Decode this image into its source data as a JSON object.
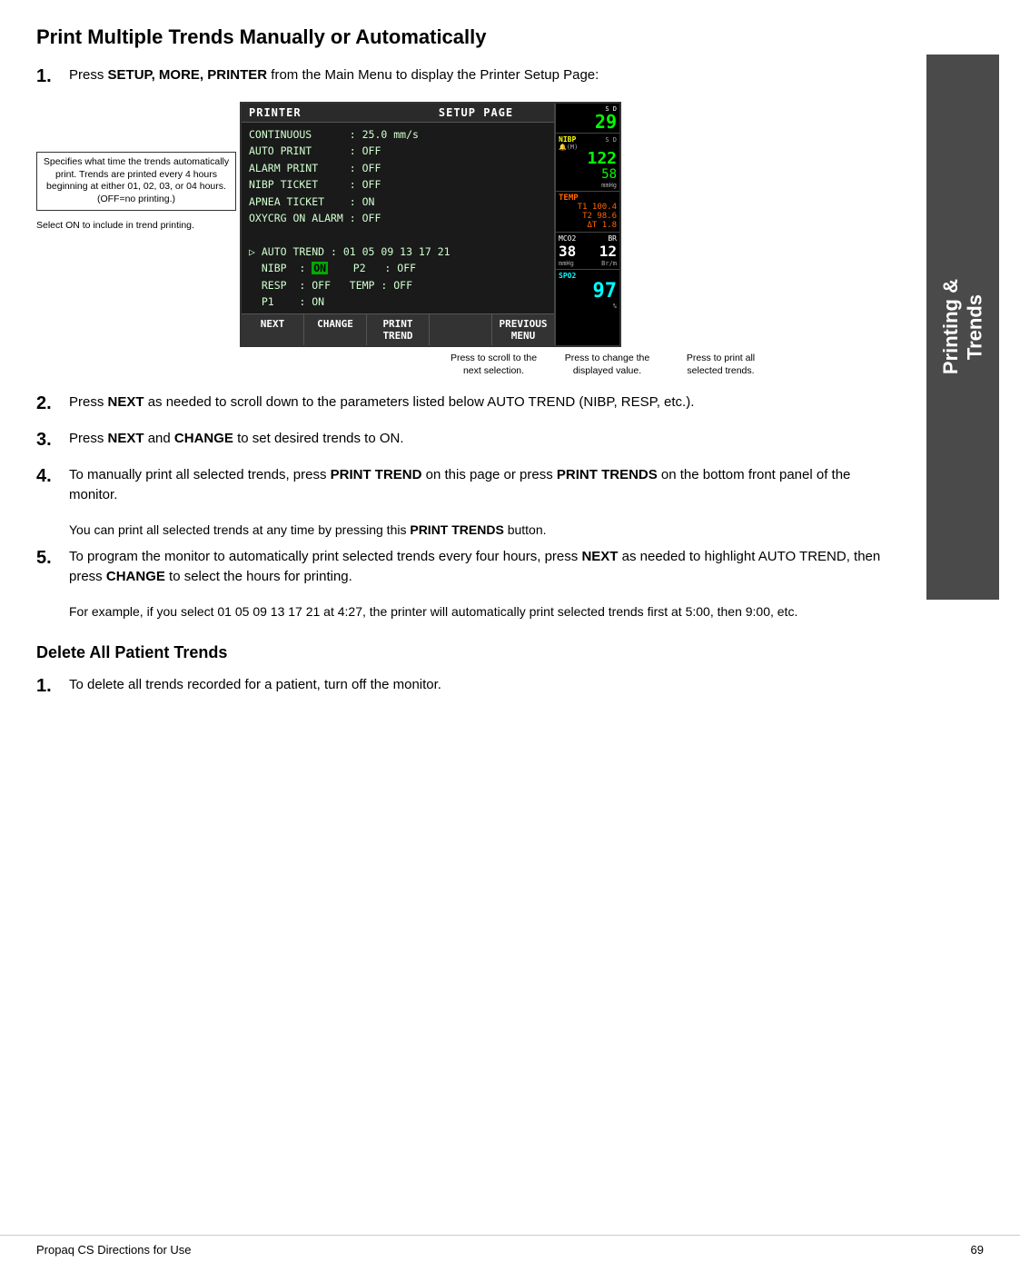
{
  "page": {
    "title": "Print Multiple Trends Manually or Automatically",
    "footer_left": "Propaq CS Directions for Use",
    "footer_right": "69"
  },
  "sidebar": {
    "line1": "Printing &",
    "line2": "Trends"
  },
  "steps": [
    {
      "number": "1.",
      "text": "Press ",
      "bold1": "SETUP, MORE, PRINTER",
      "text2": " from the Main Menu to display the Printer Setup Page:"
    },
    {
      "number": "2.",
      "text": "Press ",
      "bold1": "NEXT",
      "text2": " as needed to scroll down to the parameters listed below AUTO TREND (NIBP, RESP, etc.)."
    },
    {
      "number": "3.",
      "text": "Press ",
      "bold1": "NEXT",
      "text2": " and ",
      "bold2": "CHANGE",
      "text3": " to set desired trends to ON."
    },
    {
      "number": "4.",
      "text": "To manually print all selected trends, press ",
      "bold1": "PRINT TREND",
      "text2": " on this page or press ",
      "bold2": "PRINT TRENDS",
      "text3": " on the bottom front panel of the monitor.",
      "subtext": "You can print all selected trends at any time by pressing this ",
      "subbold": "PRINT TRENDS",
      "subtext2": " button."
    },
    {
      "number": "5.",
      "text": "To program the monitor to automatically print selected trends every four hours, press ",
      "bold1": "NEXT",
      "text2": " as needed to highlight AUTO TREND, then press ",
      "bold2": "CHANGE",
      "text3": " to select the hours for printing.",
      "subtext": "For example, if you select 01 05 09 13 17 21 at 4:27, the printer will automatically print selected trends first at 5:00, then 9:00, etc."
    }
  ],
  "section2": {
    "title": "Delete All Patient Trends",
    "step1_number": "1.",
    "step1_text": "To delete all trends recorded for a patient, turn off the monitor."
  },
  "printer_screen": {
    "header_left": "PRINTER",
    "header_right": "SETUP PAGE",
    "lines": [
      "CONTINUOUS      : 25.0 mm/s",
      "AUTO PRINT      : OFF",
      "ALARM PRINT     : OFF",
      "NIBP TICKET     : OFF",
      "APNEA TICKET    : ON",
      "OXYCRG ON ALARM : OFF",
      "",
      "> AUTO TREND : 01 05 09 13 17 21",
      "  NIBP  : ON    P2   : OFF",
      "  RESP  : OFF   TEMP : OFF",
      "  P1    : ON"
    ],
    "buttons": [
      "NEXT",
      "CHANGE",
      "PRINT\nTREND",
      "",
      "PREVIOUS\nMENU"
    ]
  },
  "vitals": {
    "top_label": "S D",
    "nibp_label": "NIBP",
    "nibp_m": "(M)",
    "nibp_val": "122",
    "nibp_sub": "58",
    "nibp_mmhg": "mmHg",
    "temp_label": "TEMP",
    "temp_t1": "T1 100.4",
    "temp_t2": "T2  98.6",
    "temp_dt": "ΔT   1.8",
    "co2_label": "MCO2",
    "co2_val": "38",
    "br_label": "BR",
    "br_val": "12",
    "spo2_label": "SPO2",
    "spo2_val": "97"
  },
  "annotations": {
    "left1": "Specifies what time the trends automatically print. Trends are printed every 4 hours beginning at either 01, 02, 03, or 04 hours. (OFF=no printing.)",
    "left2": "Select ON to include in trend printing.",
    "bottom1": "Press to scroll to the next selection.",
    "bottom2": "Press to change the displayed value.",
    "bottom3": "Press to print all selected trends."
  }
}
